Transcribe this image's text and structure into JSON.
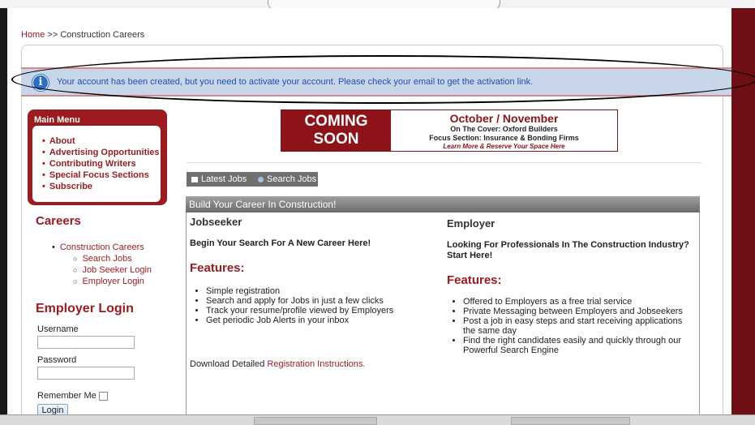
{
  "breadcrumb": {
    "home": "Home",
    "sep": ">>",
    "current": "Construction Careers"
  },
  "notice": {
    "icon": "info-icon",
    "message": "Your account has been created, but you need to activate your account. Please check your email to get the activation link."
  },
  "main_menu": {
    "title": "Main Menu",
    "items": [
      "About",
      "Advertising Opportunities",
      "Contributing Writers",
      "Special Focus Sections",
      "Subscribe"
    ]
  },
  "careers": {
    "title": "Careers",
    "top": "Construction Careers",
    "sub": [
      "Search Jobs",
      "Job Seeker Login",
      "Employer Login"
    ]
  },
  "login": {
    "title": "Employer Login",
    "username_label": "Username",
    "password_label": "Password",
    "remember_label": "Remember Me",
    "button": "Login"
  },
  "banner": {
    "left_line1": "COMING",
    "left_line2": "SOON",
    "title": "October / November",
    "line2": "On The Cover: Oxford Builders",
    "line3": "Focus Section: Insurance & Bonding Firms",
    "line4": "Learn More & Reserve Your Space Here"
  },
  "job_tabs": {
    "latest": "Latest Jobs",
    "search": "Search Jobs"
  },
  "build_header": "Build Your Career In Construction!",
  "jobseeker": {
    "title": "Jobseeker",
    "tagline": "Begin Your Search For A New Career Here!",
    "features_title": "Features:",
    "features": [
      "Simple registration",
      "Search and apply for Jobs in just a few clicks",
      "Track your resume/profile viewed by Employers",
      "Get periodic Job Alerts in your inbox"
    ],
    "download_prefix": "Download Detailed ",
    "download_link": "Registration Instructions."
  },
  "employer": {
    "title": "Employer",
    "tagline": "Looking For Professionals In The Construction Industry? Start Here!",
    "features_title": "Features:",
    "features": [
      "Offered to Employers as a free trial service",
      "Private Messaging between Employers and Jobseekers",
      "Post a job in easy steps and start receiving applications the same day",
      "Find the right candidates easily and quickly through our Powerful Search Engine"
    ]
  },
  "colors": {
    "accent": "#9b1b1f",
    "notice_bg": "#c8d6ea",
    "link_blue": "#1f4fb0"
  }
}
